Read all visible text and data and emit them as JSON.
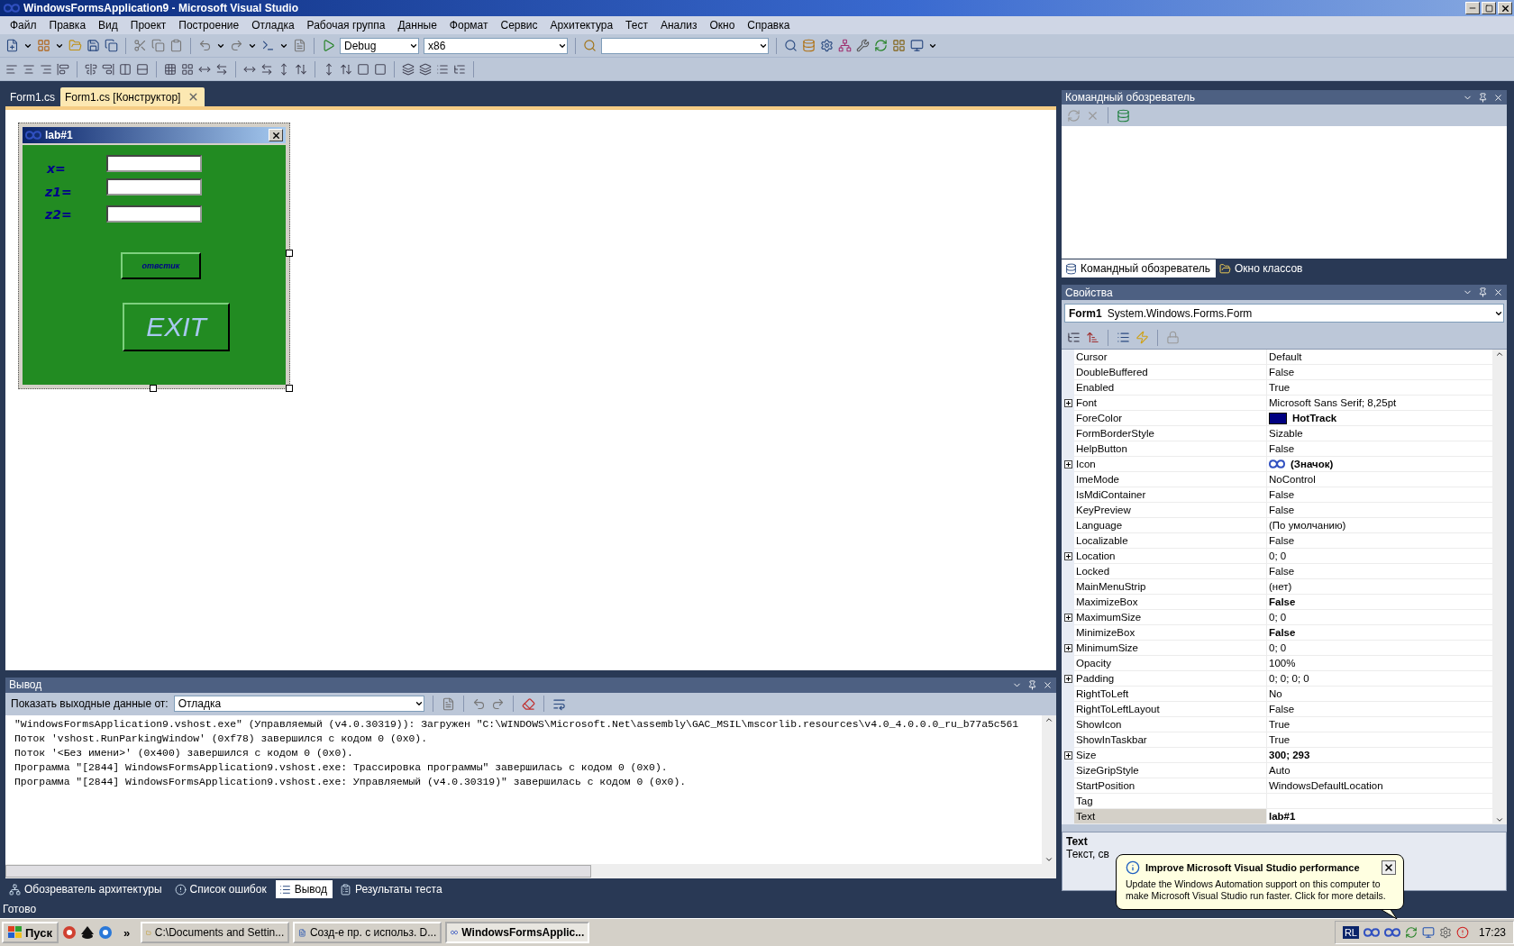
{
  "window": {
    "title": "WindowsFormsApplication9 - Microsoft Visual Studio"
  },
  "menu": [
    "Файл",
    "Правка",
    "Вид",
    "Проект",
    "Построение",
    "Отладка",
    "Рабочая группа",
    "Данные",
    "Формат",
    "Сервис",
    "Архитектура",
    "Тест",
    "Анализ",
    "Окно",
    "Справка"
  ],
  "toolbar": {
    "configuration": "Debug",
    "platform": "x86"
  },
  "document_tabs": [
    {
      "label": "Form1.cs",
      "selected": false
    },
    {
      "label": "Form1.cs [Конструктор]",
      "selected": true
    }
  ],
  "designer_form": {
    "title": "lab#1",
    "labels": [
      "x=",
      "z1=",
      "z2="
    ],
    "buttons": [
      {
        "label": "отвстик",
        "kind": "small"
      },
      {
        "label": "EXIT",
        "kind": "large"
      }
    ]
  },
  "team_explorer": {
    "title": "Командный обозреватель",
    "tabs": [
      {
        "label": "Командный обозреватель",
        "selected": true
      },
      {
        "label": "Окно классов",
        "selected": false
      }
    ]
  },
  "properties": {
    "title": "Свойства",
    "object_name": "Form1",
    "object_type": "System.Windows.Forms.Form",
    "rows": [
      {
        "name": "Cursor",
        "value": "Default",
        "expandable": false,
        "bold": false,
        "selected": false,
        "kind": "plain"
      },
      {
        "name": "DoubleBuffered",
        "value": "False",
        "expandable": false,
        "bold": false,
        "selected": false,
        "kind": "plain"
      },
      {
        "name": "Enabled",
        "value": "True",
        "expandable": false,
        "bold": false,
        "selected": false,
        "kind": "plain"
      },
      {
        "name": "Font",
        "value": "Microsoft Sans Serif; 8,25pt",
        "expandable": true,
        "bold": false,
        "selected": false,
        "kind": "plain"
      },
      {
        "name": "ForeColor",
        "value": "HotTrack",
        "expandable": false,
        "bold": true,
        "selected": false,
        "kind": "color",
        "color": "#000080"
      },
      {
        "name": "FormBorderStyle",
        "value": "Sizable",
        "expandable": false,
        "bold": false,
        "selected": false,
        "kind": "plain"
      },
      {
        "name": "HelpButton",
        "value": "False",
        "expandable": false,
        "bold": false,
        "selected": false,
        "kind": "plain"
      },
      {
        "name": "Icon",
        "value": "(Значок)",
        "expandable": true,
        "bold": true,
        "selected": false,
        "kind": "icon"
      },
      {
        "name": "ImeMode",
        "value": "NoControl",
        "expandable": false,
        "bold": false,
        "selected": false,
        "kind": "plain"
      },
      {
        "name": "IsMdiContainer",
        "value": "False",
        "expandable": false,
        "bold": false,
        "selected": false,
        "kind": "plain"
      },
      {
        "name": "KeyPreview",
        "value": "False",
        "expandable": false,
        "bold": false,
        "selected": false,
        "kind": "plain"
      },
      {
        "name": "Language",
        "value": "(По умолчанию)",
        "expandable": false,
        "bold": false,
        "selected": false,
        "kind": "plain"
      },
      {
        "name": "Localizable",
        "value": "False",
        "expandable": false,
        "bold": false,
        "selected": false,
        "kind": "plain"
      },
      {
        "name": "Location",
        "value": "0; 0",
        "expandable": true,
        "bold": false,
        "selected": false,
        "kind": "plain"
      },
      {
        "name": "Locked",
        "value": "False",
        "expandable": false,
        "bold": false,
        "selected": false,
        "kind": "plain"
      },
      {
        "name": "MainMenuStrip",
        "value": "(нет)",
        "expandable": false,
        "bold": false,
        "selected": false,
        "kind": "plain"
      },
      {
        "name": "MaximizeBox",
        "value": "False",
        "expandable": false,
        "bold": true,
        "selected": false,
        "kind": "plain"
      },
      {
        "name": "MaximumSize",
        "value": "0; 0",
        "expandable": true,
        "bold": false,
        "selected": false,
        "kind": "plain"
      },
      {
        "name": "MinimizeBox",
        "value": "False",
        "expandable": false,
        "bold": true,
        "selected": false,
        "kind": "plain"
      },
      {
        "name": "MinimumSize",
        "value": "0; 0",
        "expandable": true,
        "bold": false,
        "selected": false,
        "kind": "plain"
      },
      {
        "name": "Opacity",
        "value": "100%",
        "expandable": false,
        "bold": false,
        "selected": false,
        "kind": "plain"
      },
      {
        "name": "Padding",
        "value": "0; 0; 0; 0",
        "expandable": true,
        "bold": false,
        "selected": false,
        "kind": "plain"
      },
      {
        "name": "RightToLeft",
        "value": "No",
        "expandable": false,
        "bold": false,
        "selected": false,
        "kind": "plain"
      },
      {
        "name": "RightToLeftLayout",
        "value": "False",
        "expandable": false,
        "bold": false,
        "selected": false,
        "kind": "plain"
      },
      {
        "name": "ShowIcon",
        "value": "True",
        "expandable": false,
        "bold": false,
        "selected": false,
        "kind": "plain"
      },
      {
        "name": "ShowInTaskbar",
        "value": "True",
        "expandable": false,
        "bold": false,
        "selected": false,
        "kind": "plain"
      },
      {
        "name": "Size",
        "value": "300; 293",
        "expandable": true,
        "bold": true,
        "selected": false,
        "kind": "plain"
      },
      {
        "name": "SizeGripStyle",
        "value": "Auto",
        "expandable": false,
        "bold": false,
        "selected": false,
        "kind": "plain"
      },
      {
        "name": "StartPosition",
        "value": "WindowsDefaultLocation",
        "expandable": false,
        "bold": false,
        "selected": false,
        "kind": "plain"
      },
      {
        "name": "Tag",
        "expandable": false,
        "selected": false,
        "kind": "plain"
      },
      {
        "name": "Text",
        "value": "lab#1",
        "expandable": false,
        "bold": true,
        "selected": true,
        "kind": "plain"
      }
    ],
    "description_title": "Text",
    "description": "Текст, св"
  },
  "output": {
    "title": "Вывод",
    "source_label": "Показать выходные данные от:",
    "source": "Отладка",
    "lines": [
      "\"WindowsFormsApplication9.vshost.exe\" (Управляемый (v4.0.30319)): Загружен \"C:\\WINDOWS\\Microsoft.Net\\assembly\\GAC_MSIL\\mscorlib.resources\\v4.0_4.0.0.0_ru_b77a5c561",
      "Поток 'vshost.RunParkingWindow' (0xf78) завершился с кодом 0 (0x0).",
      "Поток '<Без имени>' (0x400) завершился с кодом 0 (0x0).",
      "Программа \"[2844] WindowsFormsApplication9.vshost.exe: Трассировка программы\" завершилась с кодом 0 (0x0).",
      "Программа \"[2844] WindowsFormsApplication9.vshost.exe: Управляемый (v4.0.30319)\" завершилась с кодом 0 (0x0)."
    ]
  },
  "bottom_tabs": [
    {
      "label": "Обозреватель архитектуры",
      "selected": false
    },
    {
      "label": "Список ошибок",
      "selected": false
    },
    {
      "label": "Вывод",
      "selected": true
    },
    {
      "label": "Результаты теста",
      "selected": false
    }
  ],
  "status_bar": "Готово",
  "taskbar": {
    "start": "Пуск",
    "overflow": "»",
    "tasks": [
      {
        "label": "C:\\Documents and Settin...",
        "selected": false,
        "kind": "folder"
      },
      {
        "label": "Созд-е пр. с использ. D...",
        "selected": false,
        "kind": "document"
      },
      {
        "label": "WindowsFormsApplic...",
        "selected": true,
        "kind": "studio"
      }
    ],
    "language": "RL",
    "clock": "17:23"
  },
  "balloon": {
    "title": "Improve Microsoft Visual Studio performance",
    "text": "Update the Windows Automation support on this computer to make Microsoft Visual Studio run faster. Click for more details."
  }
}
